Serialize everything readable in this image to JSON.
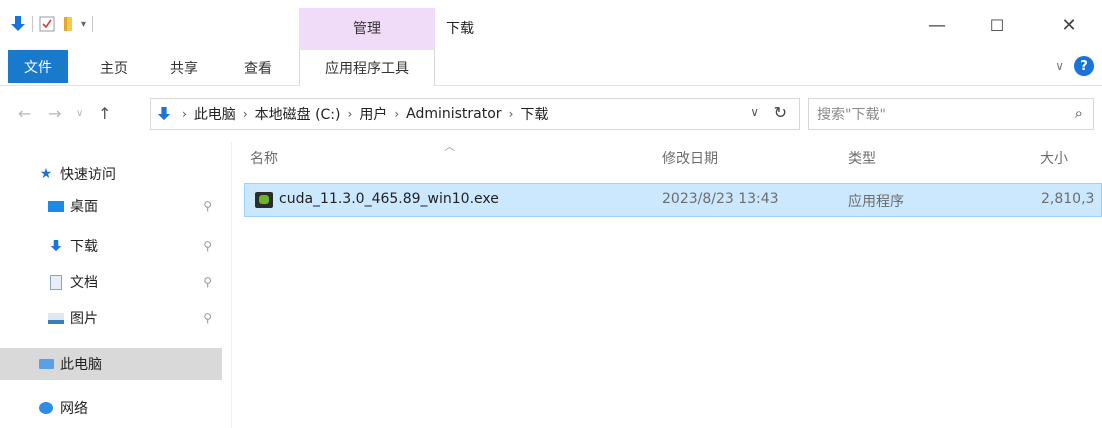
{
  "window": {
    "title": "下载",
    "context_tab": "管理",
    "controls": {
      "minimize": "—",
      "maximize": "☐",
      "close": "✕"
    }
  },
  "ribbon": {
    "tabs": [
      {
        "label": "文件",
        "active": true
      },
      {
        "label": "主页"
      },
      {
        "label": "共享"
      },
      {
        "label": "查看"
      },
      {
        "label": "应用程序工具"
      }
    ],
    "help": "?",
    "expand_icon": "chevron-down-icon"
  },
  "address": {
    "breadcrumbs": [
      "此电脑",
      "本地磁盘 (C:)",
      "用户",
      "Administrator",
      "下载"
    ]
  },
  "search": {
    "placeholder": "搜索\"下载\""
  },
  "nav_pane": {
    "quick_access": "快速访问",
    "items": [
      {
        "label": "桌面",
        "icon": "desktop-icon",
        "pinned": true
      },
      {
        "label": "下载",
        "icon": "download-icon",
        "pinned": true
      },
      {
        "label": "文档",
        "icon": "document-icon",
        "pinned": true
      },
      {
        "label": "图片",
        "icon": "picture-icon",
        "pinned": true
      }
    ],
    "this_pc": "此电脑",
    "network": "网络"
  },
  "columns": {
    "name": "名称",
    "modified": "修改日期",
    "type": "类型",
    "size": "大小"
  },
  "files": [
    {
      "name": "cuda_11.3.0_465.89_win10.exe",
      "modified": "2023/8/23 13:43",
      "type": "应用程序",
      "size": "2,810,3"
    }
  ],
  "colors": {
    "accent": "#1979ca",
    "context_tab": "#f0dcf8",
    "selection": "#cce8ff",
    "selection_border": "#99d1ff"
  }
}
